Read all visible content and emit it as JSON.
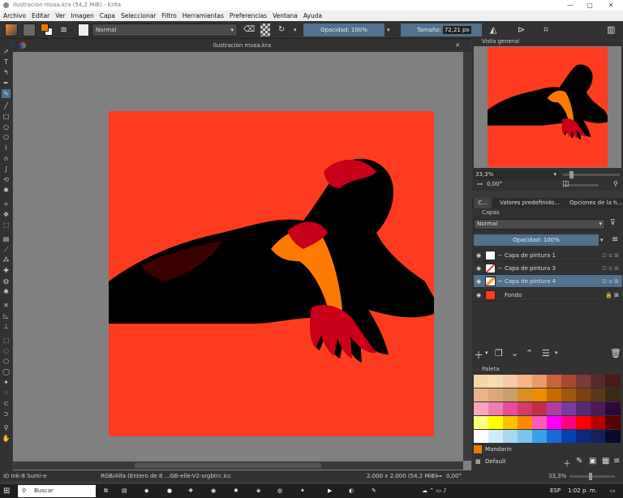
{
  "window": {
    "title": "Ilustracion musa.kra (54,2 MiB)  -  Krita",
    "min": "—",
    "max": "▢",
    "close": "✕"
  },
  "menu": [
    "Archivo",
    "Editar",
    "Ver",
    "Imagen",
    "Capa",
    "Seleccionar",
    "Filtro",
    "Herramientas",
    "Preferencias",
    "Ventana",
    "Ayuda"
  ],
  "toolbar": {
    "blend_mode": "Normal",
    "opacity": "Opacidad: 100%",
    "size_label": "Tamaño:",
    "size_value": "72,21 px"
  },
  "document": {
    "tab": "Ilustracion musa.kra",
    "close": "✕"
  },
  "overview": {
    "title": "Vista general",
    "zoom": "33,3%",
    "rotation": "0,00°"
  },
  "docker_tabs": [
    "C...",
    "Valores predefinido...",
    "Opciones de la h..."
  ],
  "layers_panel": {
    "title": "Capas",
    "blend": "Normal",
    "opacity": "Opacidad:  100%",
    "layers": [
      {
        "name": "Capa de pintura 1",
        "active": false
      },
      {
        "name": "Capa de pintura 3",
        "active": false
      },
      {
        "name": "Capa de pintura 4",
        "active": true
      },
      {
        "name": "Fondo",
        "active": false
      }
    ]
  },
  "palette_panel": {
    "title": "Paleta",
    "selected_color": "Mandarin",
    "palette_name": "Default",
    "colors": [
      "#f5d6a4",
      "#f6dbb0",
      "#f7c9a6",
      "#f4b685",
      "#e89c68",
      "#c9633a",
      "#a84a2e",
      "#7a3a35",
      "#5a2a2a",
      "#4a1a18",
      "#e9b28c",
      "#d9a77a",
      "#c8a06a",
      "#d98f1e",
      "#f08a00",
      "#c96a00",
      "#a05a10",
      "#7c3f12",
      "#5a3a1a",
      "#3a2a14",
      "#f7a6c0",
      "#f07cb0",
      "#e84b9c",
      "#d43b6a",
      "#c0304a",
      "#b040a0",
      "#7a3aa0",
      "#5a2a7a",
      "#4a1a5a",
      "#2a0a3a",
      "#ffff7a",
      "#ffff00",
      "#ffc000",
      "#ff8a00",
      "#ff5ab4",
      "#ff00ff",
      "#ff0080",
      "#ff0000",
      "#b80000",
      "#5a0000",
      "#ffffff",
      "#d0ecf8",
      "#a6d8f0",
      "#7cc4ec",
      "#3aa0e8",
      "#1a6ad8",
      "#0a40b0",
      "#0a2a80",
      "#14205a",
      "#0a0a2a"
    ]
  },
  "statusbar": {
    "brush": "d) Ink-8 Sumi-e",
    "color_profile": "RGB/Alfa (Entero de 8 ...GB-elle-V2-srgbtrc.icc",
    "dimensions": "2.000 x 2.000 (54,2 MiB)",
    "rotation": "0,00°",
    "zoom": "33,3%"
  },
  "taskbar": {
    "search": "Buscar",
    "lang": "ESP",
    "time": "1:02 p. m."
  },
  "colors": {
    "canvas_red": "#ff3b1f",
    "accent": "#50718f"
  }
}
